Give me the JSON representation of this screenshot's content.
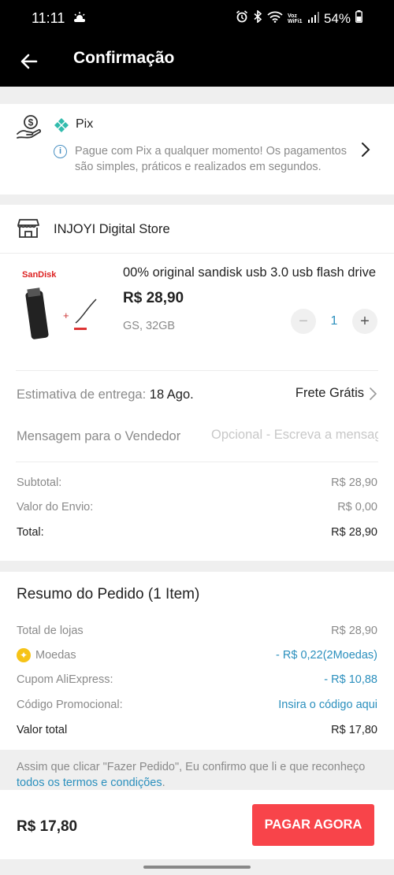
{
  "status_bar": {
    "time": "11:11",
    "network_label": "Voz WiFi1",
    "battery": "54%"
  },
  "app_bar": {
    "title": "Confirmação",
    "back_icon": "arrow-left-icon"
  },
  "payment": {
    "method": "Pix",
    "note": "Pague com Pix a qualquer momento! Os pagamentos são simples, práticos e realizados em segundos.",
    "pix_color": "#32bcad"
  },
  "store": {
    "name": "INJOYI Digital Store",
    "product": {
      "image_brand_text": "SanDisk",
      "title": "00% original sandisk usb 3.0 usb flash drive",
      "price": "R$ 28,90",
      "variant": "GS, 32GB",
      "quantity": "1"
    },
    "delivery_label": "Estimativa de entrega:",
    "delivery_date": "18 Ago.",
    "shipping": "Frete Grátis",
    "message_label": "Mensagem para o Vendedor",
    "message_placeholder": "Opcional - Escreva a mensagem",
    "subtotal_label": "Subtotal:",
    "subtotal_value": "R$ 28,90",
    "shipping_cost_label": "Valor do Envio:",
    "shipping_cost_value": "R$ 0,00",
    "total_label": "Total:",
    "total_value": "R$ 28,90"
  },
  "order_summary": {
    "title": "Resumo do Pedido (1 Item)",
    "rows": [
      {
        "label": "Total de lojas",
        "value": "R$ 28,90"
      },
      {
        "label": "Moedas",
        "value": "- R$ 0,22(2Moedas)"
      },
      {
        "label": "Cupom AliExpress:",
        "value": "- R$ 10,88"
      },
      {
        "label": "Código Promocional:",
        "value": "Insira o código aqui"
      },
      {
        "label": "Valor total",
        "value": "R$ 17,80"
      }
    ]
  },
  "terms": {
    "text": "Assim que clicar \"Fazer Pedido\", Eu confirmo que li e que reconheço ",
    "link": "todos os termos e condições",
    "end": "."
  },
  "bottom_bar": {
    "total": "R$ 17,80",
    "button": "PAGAR AGORA",
    "button_color": "#f8444a"
  },
  "colors": {
    "accent_blue": "#2a8fbd",
    "coin_yellow": "#f6c317"
  }
}
